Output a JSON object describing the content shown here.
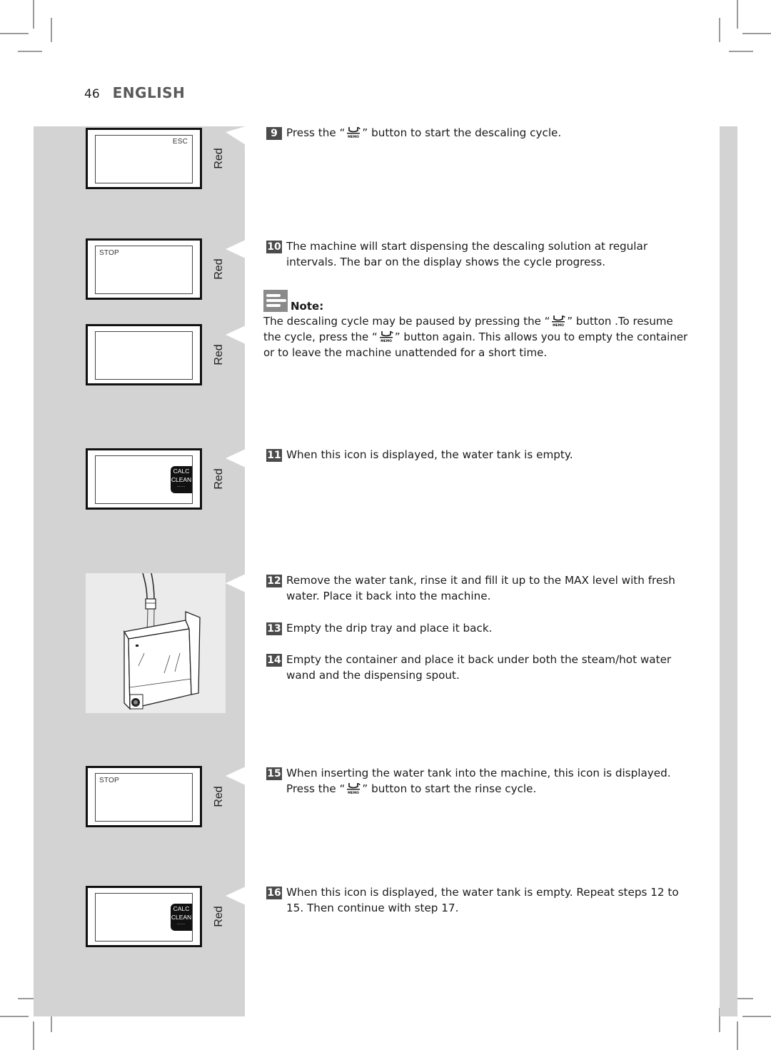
{
  "header": {
    "page_number": "46",
    "language": "ENGLISH"
  },
  "displays": [
    {
      "screen_text": "ESC",
      "led_label": "Red"
    },
    {
      "screen_text": "STOP",
      "led_label": "Red"
    },
    {
      "screen_text": "",
      "led_label": "Red"
    },
    {
      "screen_text": "",
      "badge_line1": "CALC",
      "badge_line2": "CLEAN",
      "badge_dots": "....",
      "led_label": "Red"
    },
    {
      "screen_text": "STOP",
      "led_label": "Red"
    },
    {
      "screen_text": "",
      "badge_line1": "CALC",
      "badge_line2": "CLEAN",
      "badge_dots": "....",
      "led_label": "Red"
    }
  ],
  "illustration": {
    "icon": "water-tank-filling-illustration"
  },
  "icons": {
    "memo_button": "memo-cup-icon",
    "note": "note-icon"
  },
  "steps": [
    {
      "number": "9",
      "before": "Press the “",
      "after": "” button to start the descaling cycle."
    },
    {
      "number": "10",
      "text": "The machine will start dispensing the descaling solution at regular intervals. The bar on the display shows the cycle progress."
    },
    {
      "number": "11",
      "text": "When this icon is displayed, the water tank is empty."
    },
    {
      "number": "12",
      "text": "Remove the water tank, rinse it and fill it up to the MAX level with fresh water. Place it back into the machine."
    },
    {
      "number": "13",
      "text": "Empty the drip tray and place it back."
    },
    {
      "number": "14",
      "text": "Empty the container and place it back under both the steam/hot water wand and the dispensing spout."
    },
    {
      "number": "15",
      "before": "When inserting the water tank into the machine, this icon is displayed. Press the “",
      "after": "” button to start the rinse cycle."
    },
    {
      "number": "16",
      "text": "When this icon is displayed, the water tank is empty. Repeat steps 12 to 15. Then continue with step 17."
    }
  ],
  "note": {
    "title": "Note:",
    "part1": "The descaling cycle may be paused by pressing the “",
    "part2": "” button .To resume the cycle, press the “",
    "part3": "” button again. This allows you to empty the container or to leave the machine unattended for a short time."
  }
}
